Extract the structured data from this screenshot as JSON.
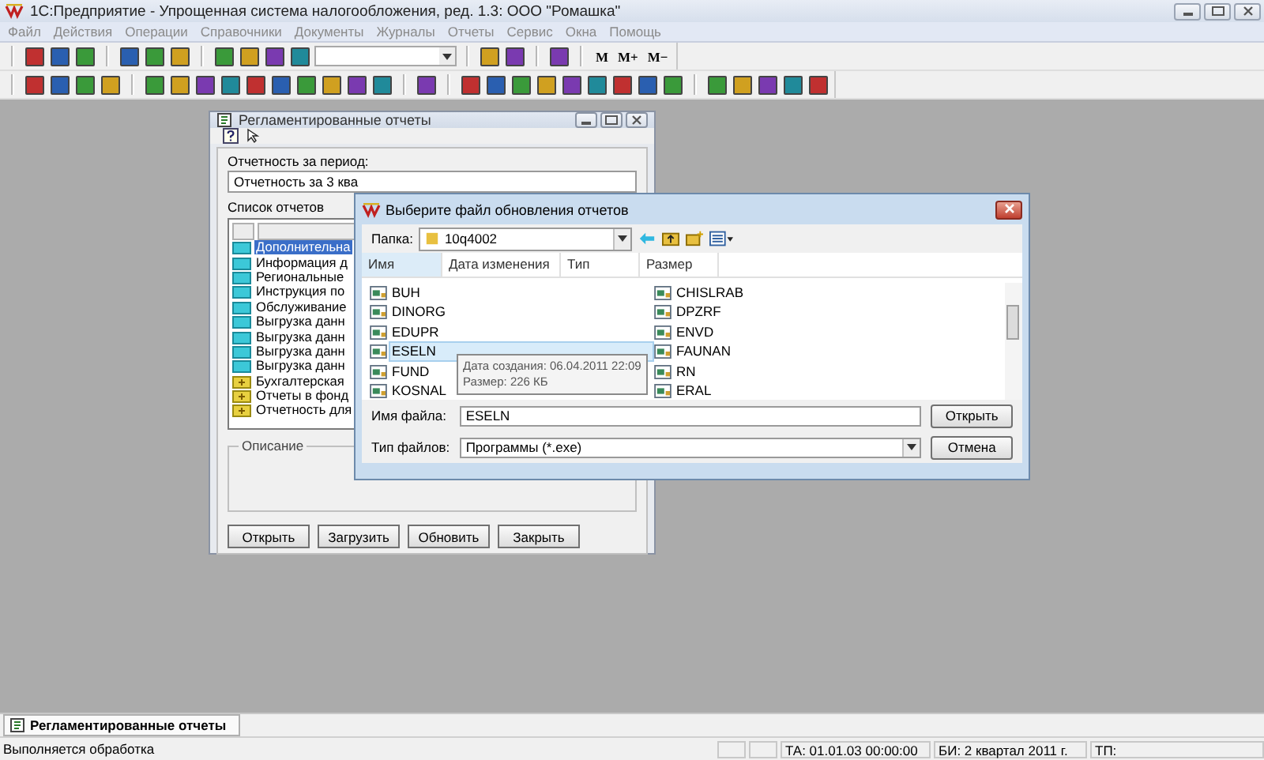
{
  "window": {
    "title": "1С:Предприятие - Упрощенная система налогообложения, ред. 1.3: ООО \"Ромашка\""
  },
  "menu": [
    {
      "label": "Файл",
      "disabled": true
    },
    {
      "label": "Действия",
      "disabled": true
    },
    {
      "label": "Операции",
      "disabled": true
    },
    {
      "label": "Справочники",
      "disabled": true
    },
    {
      "label": "Документы",
      "disabled": true
    },
    {
      "label": "Журналы",
      "disabled": true
    },
    {
      "label": "Отчеты",
      "disabled": true
    },
    {
      "label": "Сервис",
      "disabled": true
    },
    {
      "label": "Окна",
      "disabled": true
    },
    {
      "label": "Помощь",
      "disabled": true
    }
  ],
  "toolbar_text_buttons": [
    "M",
    "M+",
    "M−"
  ],
  "reports_window": {
    "title": "Регламентированные отчеты",
    "period_label": "Отчетность за период:",
    "period_value": "Отчетность за 3 ква",
    "list_label": "Список отчетов",
    "items": [
      {
        "label": "Дополнительна",
        "kind": "folder",
        "selected": true
      },
      {
        "label": "Информация д",
        "kind": "folder",
        "selected": false
      },
      {
        "label": "Региональные",
        "kind": "folder",
        "selected": false
      },
      {
        "label": "Инструкция по",
        "kind": "folder",
        "selected": false
      },
      {
        "label": "Обслуживание",
        "kind": "folder",
        "selected": false
      },
      {
        "label": "Выгрузка данн",
        "kind": "folder",
        "selected": false
      },
      {
        "label": "Выгрузка данн",
        "kind": "folder",
        "selected": false
      },
      {
        "label": "Выгрузка данн",
        "kind": "folder",
        "selected": false
      },
      {
        "label": "Выгрузка данн",
        "kind": "folder",
        "selected": false
      },
      {
        "label": "Бухгалтерская",
        "kind": "group",
        "selected": false
      },
      {
        "label": "Отчеты в фонд",
        "kind": "group",
        "selected": false
      },
      {
        "label": "Отчетность для",
        "kind": "group",
        "selected": false
      }
    ],
    "description_label": "Описание",
    "buttons": [
      "Открыть",
      "Загрузить",
      "Обновить",
      "Закрыть"
    ]
  },
  "file_dialog": {
    "title": "Выберите файл обновления отчетов",
    "folder_label": "Папка:",
    "folder": "10q4002",
    "columns": [
      "Имя",
      "Дата изменения",
      "Тип",
      "Размер"
    ],
    "files_left": [
      {
        "name": "BUH",
        "selected": false
      },
      {
        "name": "DINORG",
        "selected": false
      },
      {
        "name": "EDUPR",
        "selected": false
      },
      {
        "name": "ESELN",
        "selected": true
      },
      {
        "name": "FUND",
        "selected": false
      },
      {
        "name": "KOSNAL",
        "selected": false
      }
    ],
    "files_right": [
      {
        "name": "CHISLRAB",
        "selected": false
      },
      {
        "name": "DPZRF",
        "selected": false
      },
      {
        "name": "ENVD",
        "selected": false
      },
      {
        "name": "FAUNAN",
        "selected": false
      },
      {
        "name": "RN",
        "selected": false
      },
      {
        "name": "ERAL",
        "selected": false
      }
    ],
    "tooltip": [
      "Дата создания: 06.04.2011 22:09",
      "Размер: 226 КБ"
    ],
    "filename_label": "Имя файла:",
    "filename": "ESELN",
    "filetype_label": "Тип файлов:",
    "filetype": "Программы (*.exe)",
    "buttons": [
      "Открыть",
      "Отмена"
    ]
  },
  "taskbar": [
    {
      "label": "Регламентированные отчеты",
      "selected": true
    }
  ],
  "status_bar": {
    "message": "Выполняется обработка",
    "ta": "ТА: 01.01.03  00:00:00",
    "bi": "БИ: 2 квартал 2011 г.",
    "tp": "ТП:"
  }
}
